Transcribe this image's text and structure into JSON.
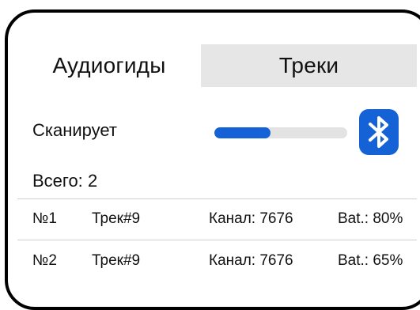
{
  "tabs": [
    {
      "label": "Аудиогиды",
      "active": false
    },
    {
      "label": "Треки",
      "active": true
    }
  ],
  "scan": {
    "status_label": "Сканирует",
    "progress_fraction": 0.42
  },
  "bluetooth": {
    "icon": "bluetooth-icon",
    "color": "#1561d6"
  },
  "total": {
    "label": "Всего:",
    "value": "2"
  },
  "devices": [
    {
      "num": "№1",
      "name": "Трек#9",
      "channel": "Канал: 7676",
      "battery": "Bat.: 80%"
    },
    {
      "num": "№2",
      "name": "Трек#9",
      "channel": "Канал: 7676",
      "battery": "Bat.: 65%"
    }
  ]
}
